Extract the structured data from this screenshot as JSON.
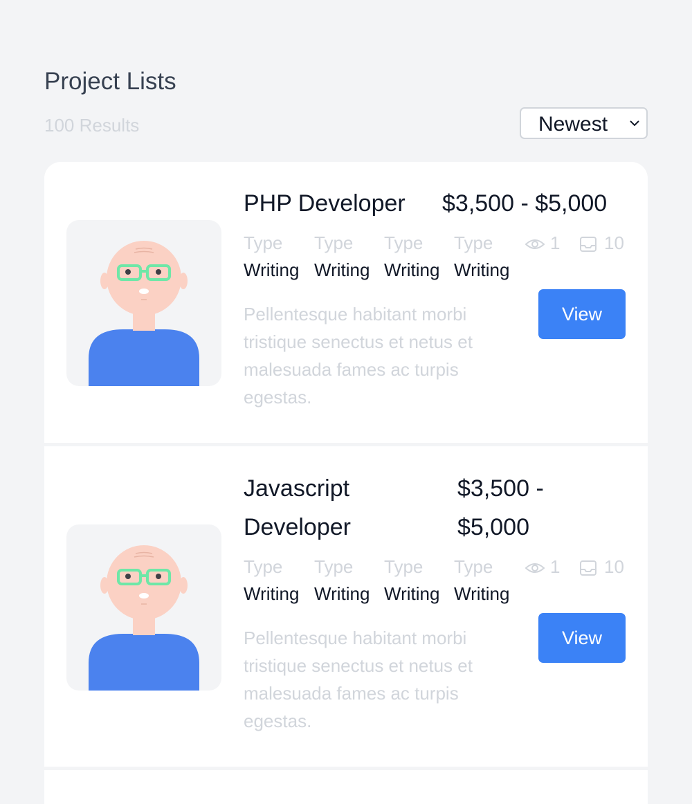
{
  "header": {
    "title": "Project Lists",
    "results": "100 Results",
    "sort_selected": "Newest"
  },
  "colors": {
    "accent": "#3b82f6",
    "avatar_shirt": "#4b82ee",
    "avatar_skin": "#fbd1c4",
    "avatar_glasses": "#6ee7a7"
  },
  "projects": [
    {
      "title": "PHP Developer",
      "price": "$3,500 - $5,000",
      "types": [
        {
          "label": "Type",
          "value": "Writing"
        },
        {
          "label": "Type",
          "value": "Writing"
        },
        {
          "label": "Type",
          "value": "Writing"
        },
        {
          "label": "Type",
          "value": "Writing"
        }
      ],
      "views": "1",
      "inbox": "10",
      "description": "Pellentesque habitant morbi tristique senectus et netus et malesuada fames ac turpis egestas.",
      "button": "View"
    },
    {
      "title_line1": "Javascript",
      "title_line2": "Developer",
      "price_line1": "$3,500 -",
      "price_line2": "$5,000",
      "types": [
        {
          "label": "Type",
          "value": "Writing"
        },
        {
          "label": "Type",
          "value": "Writing"
        },
        {
          "label": "Type",
          "value": "Writing"
        },
        {
          "label": "Type",
          "value": "Writing"
        }
      ],
      "views": "1",
      "inbox": "10",
      "description": "Pellentesque habitant morbi tristique senectus et netus et malesuada fames ac turpis egestas.",
      "button": "View"
    }
  ]
}
